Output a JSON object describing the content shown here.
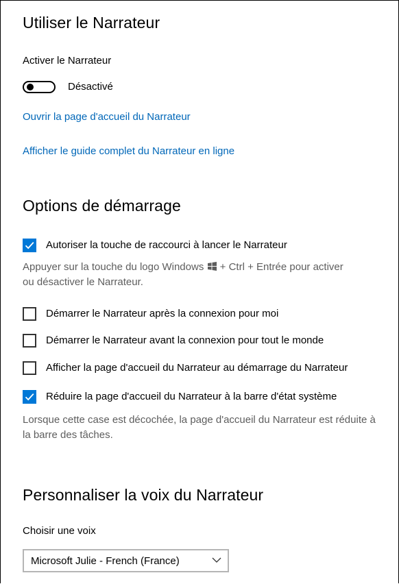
{
  "narrator": {
    "section_title": "Utiliser le Narrateur",
    "enable_label": "Activer le Narrateur",
    "toggle_state": "Désactivé",
    "toggle_on": false,
    "home_link": "Ouvrir la page d'accueil du Narrateur",
    "guide_link": "Afficher le guide complet du Narrateur en ligne"
  },
  "startup": {
    "section_title": "Options de démarrage",
    "options": [
      {
        "label": "Autoriser la touche de raccourci à lancer le Narrateur",
        "checked": true
      },
      {
        "label": "Démarrer le Narrateur après la connexion pour moi",
        "checked": false
      },
      {
        "label": "Démarrer le Narrateur avant la connexion pour tout le monde",
        "checked": false
      },
      {
        "label": "Afficher la page d'accueil du Narrateur au démarrage du Narrateur",
        "checked": false
      },
      {
        "label": "Réduire la page d'accueil du Narrateur à la barre d'état système",
        "checked": true
      }
    ],
    "shortcut_desc_1": "Appuyer sur la touche du logo Windows",
    "shortcut_desc_2": "+ Ctrl + Entrée pour activer",
    "shortcut_desc_3": "ou désactiver le Narrateur.",
    "minimize_desc": "Lorsque cette case est décochée, la page d'accueil du Narrateur est réduite à la barre des tâches."
  },
  "voice": {
    "section_title": "Personnaliser la voix du Narrateur",
    "choose_label": "Choisir une voix",
    "selected_voice": "Microsoft Julie - French (France)"
  },
  "colors": {
    "accent": "#0078d7",
    "link": "#0067b8",
    "desc_text": "#5d5d5d"
  },
  "icons": {
    "windows_logo": "windows-logo-icon",
    "checkmark": "checkmark-icon",
    "dropdown": "chevron-down-icon"
  }
}
